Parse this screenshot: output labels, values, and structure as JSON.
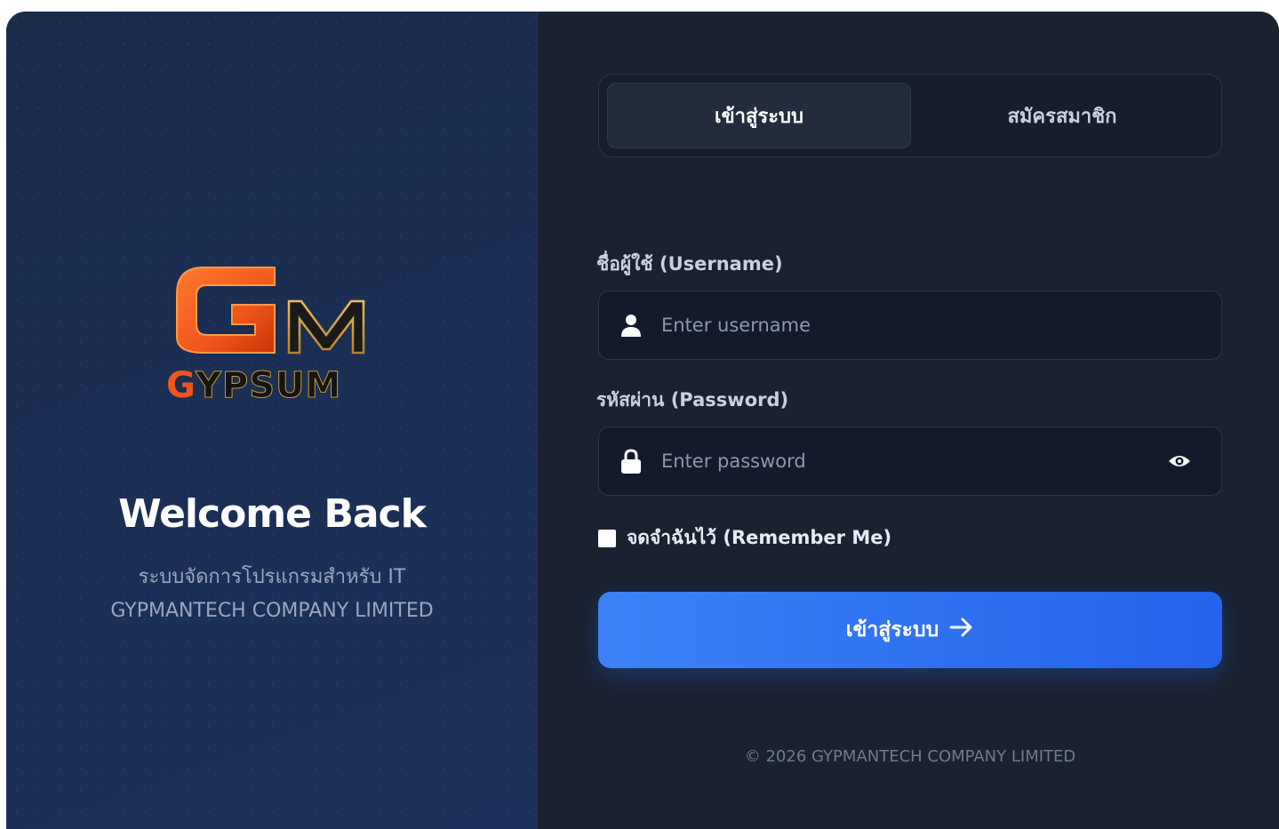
{
  "brand": {
    "logo_letters": "GM",
    "logo_word": "GYPSUM",
    "colors": {
      "orange": "#f0561a",
      "gold": "#d8a53a",
      "dark": "#1a1a1a"
    }
  },
  "left_panel": {
    "welcome_title": "Welcome Back",
    "subtitle_line1": "ระบบจัดการโปรแกรมสำหรับ IT",
    "subtitle_line2": "GYPMANTECH COMPANY LIMITED"
  },
  "tabs": [
    {
      "label": "เข้าสู่ระบบ",
      "active": true
    },
    {
      "label": "สมัครสมาชิก",
      "active": false
    }
  ],
  "form": {
    "username_label": "ชื่อผู้ใช้ (Username)",
    "username_placeholder": "Enter username",
    "username_value": "",
    "password_label": "รหัสผ่าน (Password)",
    "password_placeholder": "Enter password",
    "password_value": "",
    "remember_label": "จดจำฉันไว้ (Remember Me)",
    "remember_checked": false,
    "submit_label": "เข้าสู่ระบบ",
    "submit_icon": "arrow-right-icon"
  },
  "footer": {
    "copyright": "© 2026 GYPMANTECH COMPANY LIMITED"
  },
  "theme": {
    "accent": "#3b82f6",
    "panel_left": "#1b2f55",
    "panel_right": "#1a2232"
  }
}
